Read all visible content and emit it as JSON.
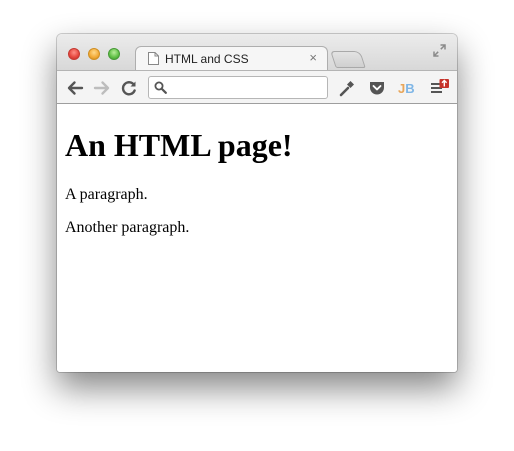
{
  "window": {
    "tab": {
      "title": "HTML and CSS",
      "close_glyph": "×"
    },
    "traffic_lights": {
      "close_color": "#e5453c",
      "minimize_color": "#f2a935",
      "maximize_color": "#5fbf45"
    }
  },
  "toolbar": {
    "omnibox": {
      "value": "",
      "placeholder": ""
    },
    "icons": [
      "back-arrow-icon",
      "forward-arrow-icon",
      "reload-icon",
      "search-icon",
      "wrench-icon",
      "pocket-icon",
      "jb-extension-icon",
      "menu-icon"
    ],
    "jb_label": {
      "j": "J",
      "b": "B"
    }
  },
  "page": {
    "heading": "An HTML page!",
    "paragraphs": [
      "A paragraph.",
      "Another paragraph."
    ]
  },
  "colors": {
    "tab_strip": "#d8d8d8",
    "toolbar": "#f4f4f4",
    "pocket": "#555555",
    "jb_j": "#e8a65a",
    "jb_b": "#7fb6e6",
    "menu_badge": "#c6332b"
  }
}
